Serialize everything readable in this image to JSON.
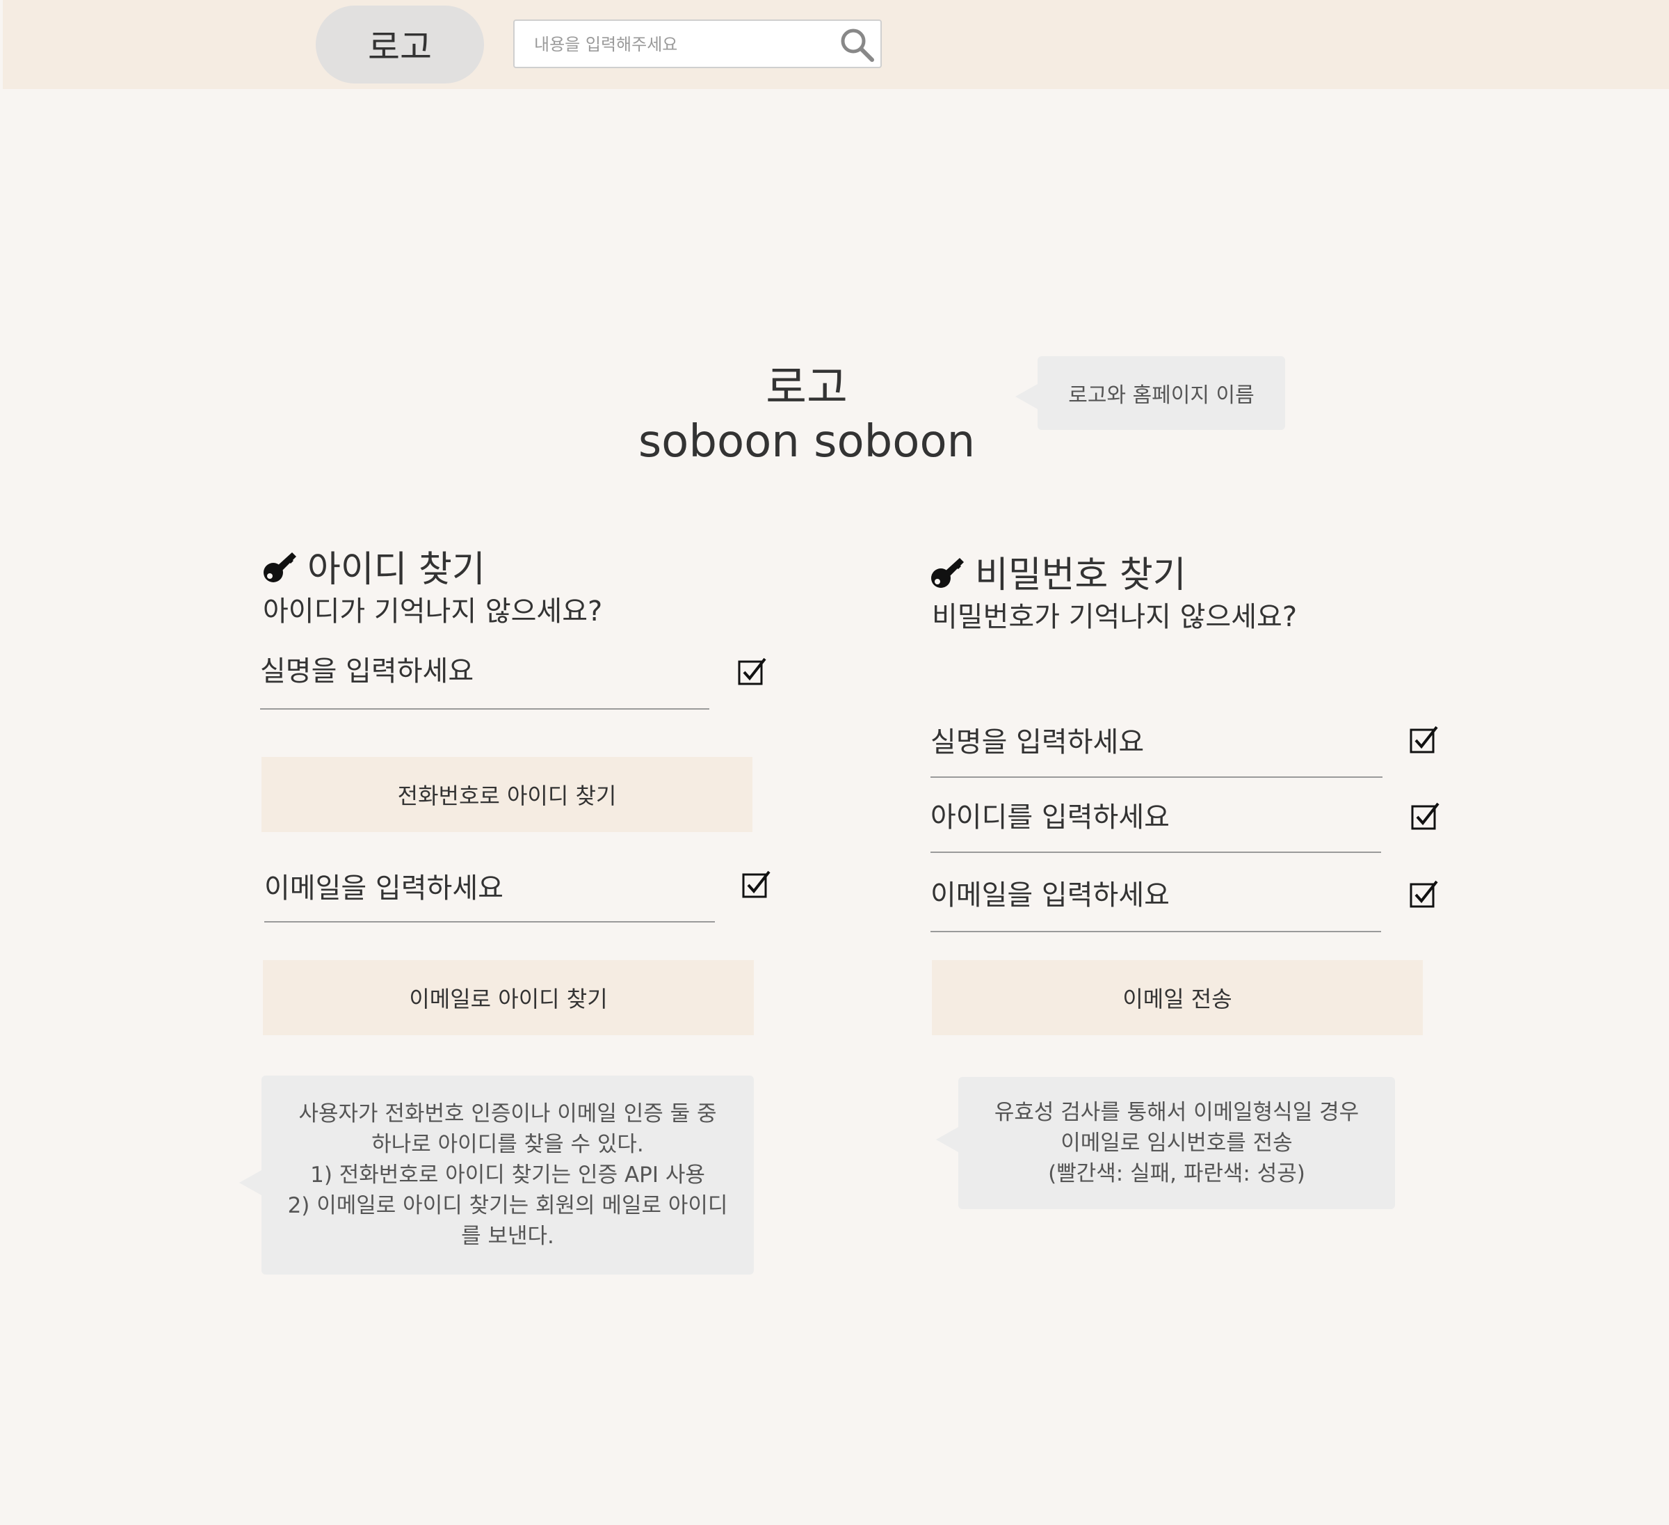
{
  "header": {
    "logo_label": "로고",
    "search": {
      "placeholder": "내용을 입력해주세요"
    }
  },
  "brand": {
    "logo": "로고",
    "name": "soboon soboon",
    "note": "로고와 홈페이지 이름"
  },
  "find_id": {
    "title": "아이디 찾기",
    "subtitle": "아이디가 기억나지 않으세요?",
    "name_placeholder": "실명을 입력하세요",
    "phone_button": "전화번호로 아이디 찾기",
    "email_placeholder": "이메일을 입력하세요",
    "email_button": "이메일로 아이디 찾기",
    "note": "사용자가 전화번호 인증이나 이메일 인증 둘 중\n하나로 아이디를 찾을 수 있다.\n1) 전화번호로 아이디 찾기는 인증 API 사용\n2) 이메일로 아이디 찾기는 회원의 메일로 아이디\n를 보낸다."
  },
  "find_pw": {
    "title": "비밀번호 찾기",
    "subtitle": "비밀번호가 기억나지 않으세요?",
    "name_placeholder": "실명을 입력하세요",
    "id_placeholder": "아이디를 입력하세요",
    "email_placeholder": "이메일을 입력하세요",
    "send_button": "이메일 전송",
    "note": "유효성 검사를 통해서 이메일형식일 경우\n이메일로 임시번호를 전송\n(빨간색: 실패, 파란색: 성공)"
  },
  "colors": {
    "header_bg": "#f5ece2",
    "page_bg": "#f8f5f2",
    "button_bg": "#f5ece2",
    "note_bg": "#ececec",
    "logo_pill_bg": "#e1e0df"
  },
  "icons": {
    "search": "search-icon",
    "key": "key-icon",
    "check": "checkbox-checked-icon"
  }
}
